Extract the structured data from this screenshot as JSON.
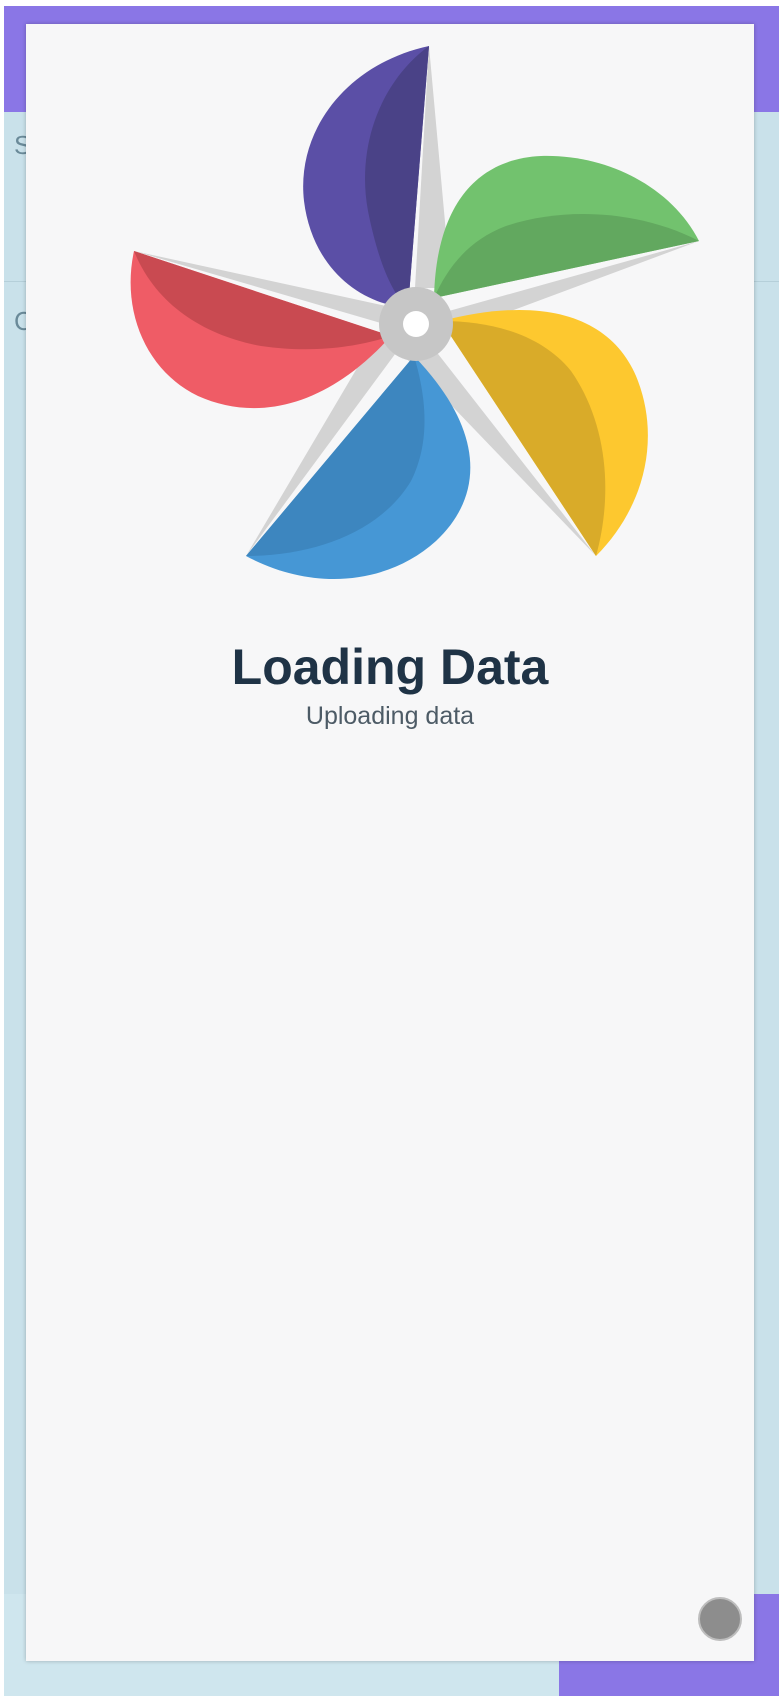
{
  "background": {
    "section_letter_1": "S",
    "section_letter_2": "C"
  },
  "loading": {
    "title": "Loading Data",
    "subtitle": "Uploading data",
    "logo": "pinwheel-icon"
  },
  "colors": {
    "accent": "#8a76e6",
    "backdrop": "#c9e1ea",
    "modal": "#f7f7f8",
    "title": "#1f3346",
    "subtitle": "#4d5b66",
    "blade_purple": "#5b4fa6",
    "blade_green": "#72c26e",
    "blade_yellow": "#fdc82f",
    "blade_blue": "#4697d5",
    "blade_red": "#ef5c66"
  },
  "status_indicator": "loading-spinner-icon"
}
